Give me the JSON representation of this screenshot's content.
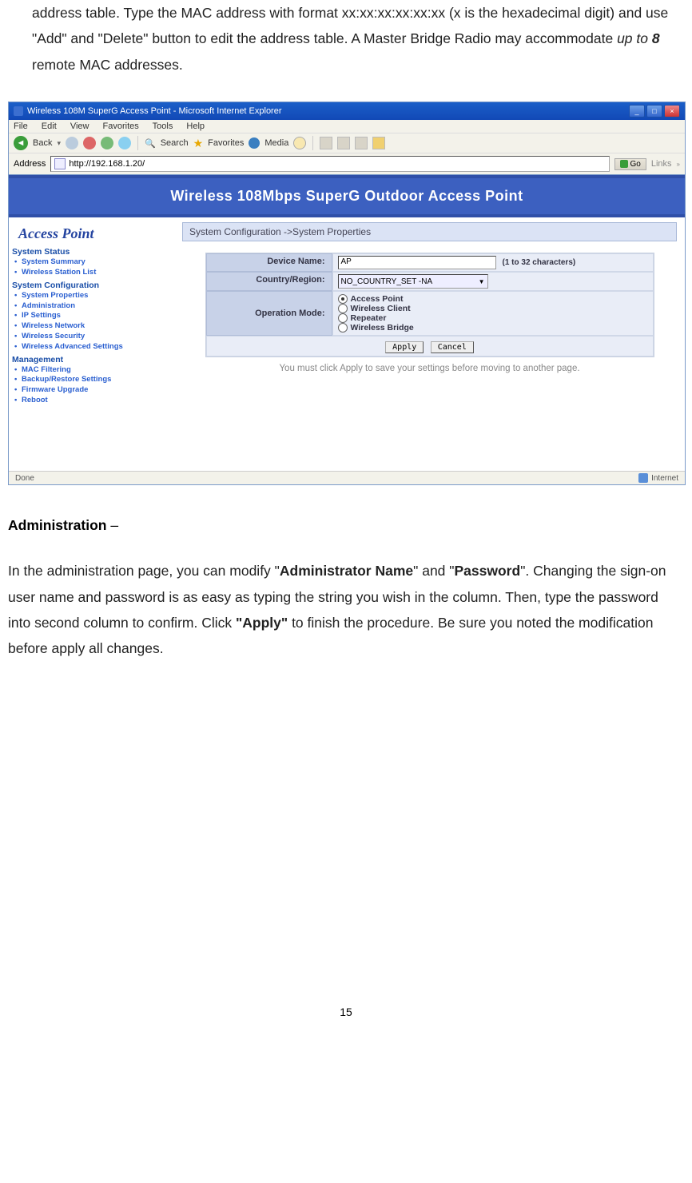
{
  "intro_para": {
    "p1a": "address table.    Type the MAC address with format xx:xx:xx:xx:xx:xx (x is the hexadecimal digit) and use \"Add\" and \"Delete\" button to edit the address table.    A Master Bridge Radio may accommodate ",
    "p1b_it": "up to ",
    "p1c_bi": "8",
    "p1d": " remote MAC addresses."
  },
  "heading": {
    "title": "Administration",
    "dash": " – "
  },
  "admin_para": {
    "a": "In the administration page, you can modify \"",
    "b_bold": "Administrator Name",
    "c": "\" and \"",
    "d_bold": "Password",
    "e": "\". Changing the sign-on user name and password is as easy as typing the string you wish in the column. Then, type the password into second column to confirm. Click ",
    "f_bold": "\"Apply\"",
    "g": " to finish the procedure. Be sure you noted the modification before apply all changes."
  },
  "page_number": "15",
  "screenshot": {
    "window_title": "Wireless 108M SuperG Access Point - Microsoft Internet Explorer",
    "menubar": [
      "File",
      "Edit",
      "View",
      "Favorites",
      "Tools",
      "Help"
    ],
    "toolbar": {
      "back": "Back",
      "search": "Search",
      "favorites": "Favorites",
      "media": "Media"
    },
    "address_label": "Address",
    "url": "http://192.168.1.20/",
    "go": "Go",
    "links": "Links",
    "banner": "Wireless 108Mbps SuperG Outdoor Access Point",
    "sidebar": {
      "title": "Access Point",
      "cat1": "System Status",
      "cat1_items": [
        "System Summary",
        "Wireless Station List"
      ],
      "cat2": "System Configuration",
      "cat2_items": [
        "System Properties",
        "Administration",
        "IP Settings",
        "Wireless Network",
        "Wireless Security",
        "Wireless Advanced Settings"
      ],
      "cat3": "Management",
      "cat3_items": [
        "MAC Filtering",
        "Backup/Restore Settings",
        "Firmware Upgrade",
        "Reboot"
      ]
    },
    "breadcrumb": "System Configuration ->System Properties",
    "form": {
      "device_name_lbl": "Device Name:",
      "device_name_val": "AP",
      "device_name_hint": "(1 to 32 characters)",
      "country_lbl": "Country/Region:",
      "country_val": "NO_COUNTRY_SET -NA",
      "op_lbl": "Operation Mode:",
      "op_options": [
        "Access Point",
        "Wireless Client",
        "Repeater",
        "Wireless Bridge"
      ],
      "apply": "Apply",
      "cancel": "Cancel"
    },
    "note": "You must click Apply to save your settings before moving to another page.",
    "status_done": "Done",
    "status_net": "Internet"
  }
}
